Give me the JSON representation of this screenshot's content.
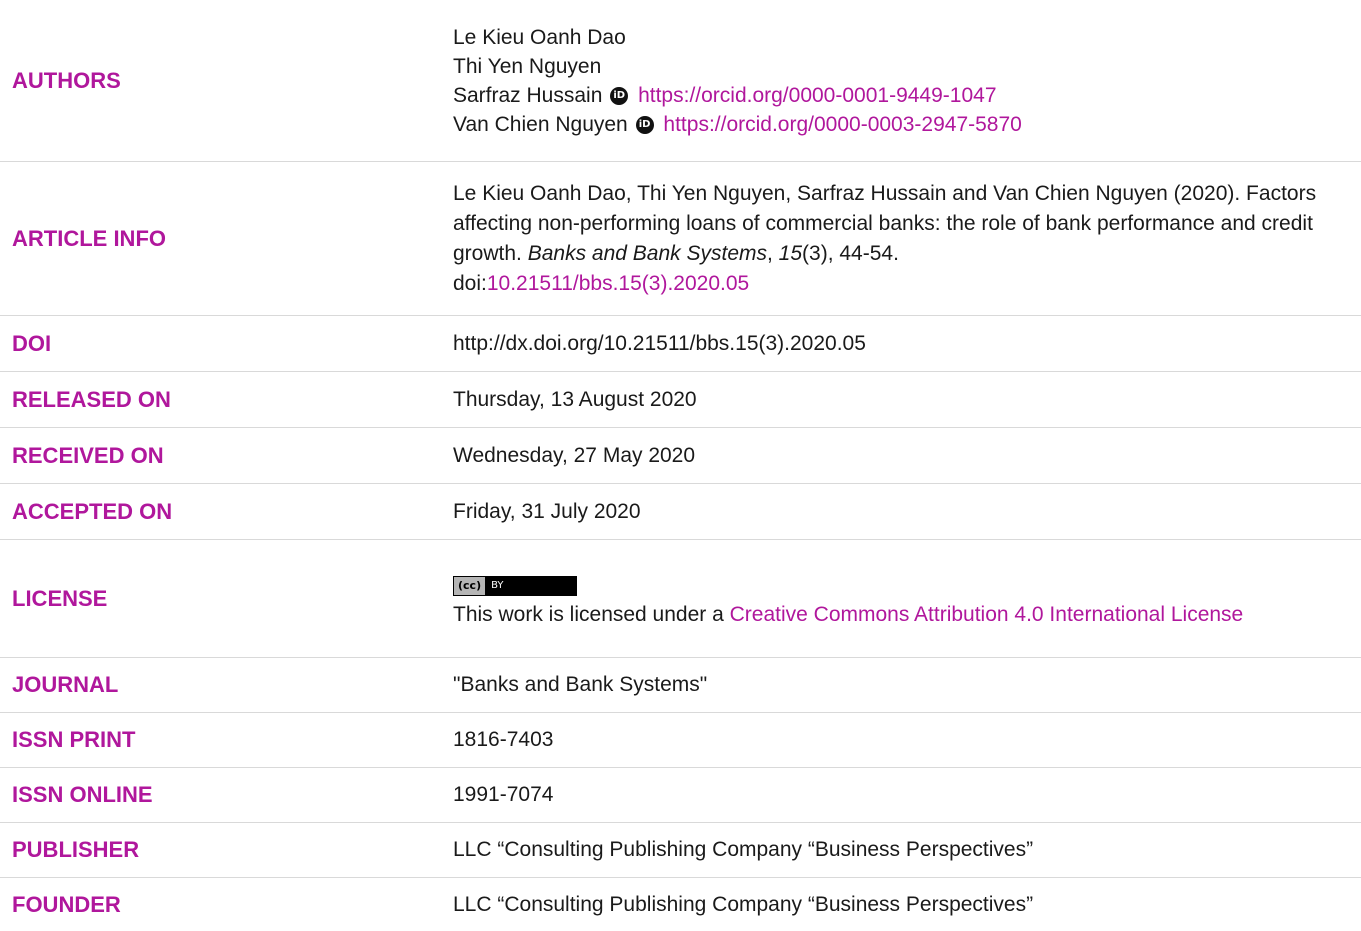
{
  "authors": {
    "label": "AUTHORS",
    "names": [
      "Le Kieu Oanh Dao",
      "Thi Yen Nguyen",
      "Sarfraz Hussain",
      "Van Chien Nguyen"
    ],
    "orcid_hussain": "https://orcid.org/0000-0001-9449-1047",
    "orcid_nguyen": "https://orcid.org/0000-0003-2947-5870",
    "orcid_icon_text": "iD"
  },
  "article_info": {
    "label": "ARTICLE INFO",
    "citation_part1": "Le Kieu Oanh Dao, Thi Yen Nguyen, Sarfraz Hussain and Van Chien Nguyen (2020). Factors affecting non-performing loans of commercial banks: the role of bank performance and credit growth. ",
    "journal_italic": "Banks and Bank Systems",
    "comma": ", ",
    "volume_italic": "15",
    "citation_part2": "(3), 44-54.",
    "doi_prefix": "doi:",
    "doi_link": "10.21511/bbs.15(3).2020.05"
  },
  "doi": {
    "label": "DOI",
    "value": "http://dx.doi.org/10.21511/bbs.15(3).2020.05"
  },
  "released_on": {
    "label": "RELEASED ON",
    "value": "Thursday, 13 August 2020"
  },
  "received_on": {
    "label": "RECEIVED ON",
    "value": "Wednesday, 27 May 2020"
  },
  "accepted_on": {
    "label": "ACCEPTED ON",
    "value": "Friday, 31 July 2020"
  },
  "license": {
    "label": "LICENSE",
    "badge_left": "(cc)",
    "badge_right": "BY",
    "text_prefix": "This work is licensed under a ",
    "text_link": "Creative Commons Attribution 4.0 International License"
  },
  "journal": {
    "label": "JOURNAL",
    "value": "\"Banks and Bank Systems\""
  },
  "issn_print": {
    "label": "ISSN PRINT",
    "value": "1816-7403"
  },
  "issn_online": {
    "label": "ISSN ONLINE",
    "value": "1991-7074"
  },
  "publisher": {
    "label": "PUBLISHER",
    "value": "LLC “Consulting Publishing Company “Business Perspectives”"
  },
  "founder": {
    "label": "FOUNDER",
    "value": "LLC “Consulting Publishing Company “Business Perspectives”"
  },
  "colors": {
    "label": "#b0179c",
    "link": "#b0179c",
    "divider": "#d9d9d9"
  }
}
